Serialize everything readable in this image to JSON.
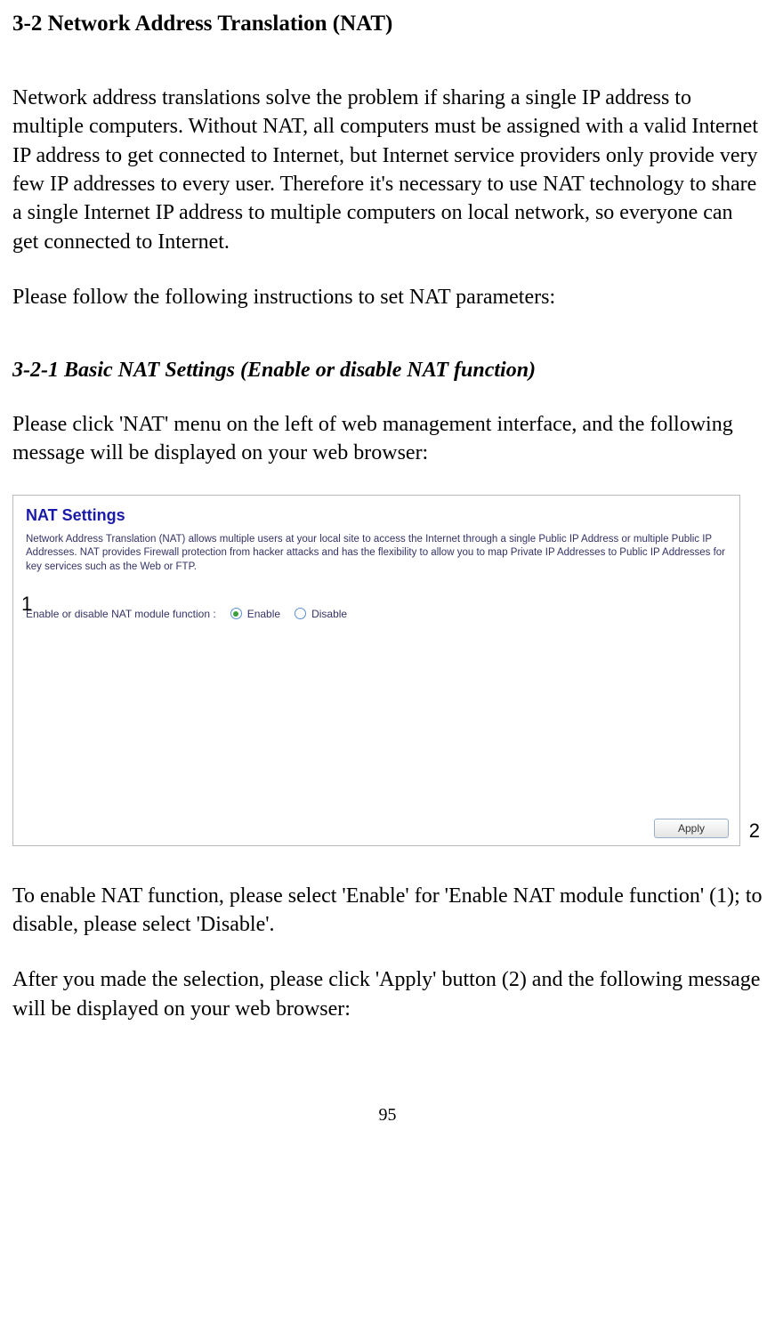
{
  "section": {
    "title": "3-2 Network Address Translation (NAT)",
    "para1": "Network address translations solve the problem if sharing a single IP address to multiple computers. Without NAT, all computers must be assigned with a valid Internet IP address to get connected to Internet, but Internet service providers only provide very few IP addresses to every user. Therefore it's necessary to use NAT technology to share a single Internet IP address to multiple computers on local network, so everyone can get connected to Internet.",
    "para2": "Please follow the following instructions to set NAT parameters:"
  },
  "subsection": {
    "title": "3-2-1 Basic NAT Settings (Enable or disable NAT function)",
    "para1": "Please click 'NAT' menu on the left of web management interface, and the following message will be displayed on your web browser:"
  },
  "screenshot": {
    "title": "NAT Settings",
    "desc": "Network Address Translation (NAT) allows multiple users at your local site to access the Internet through a single Public IP Address or multiple Public IP Addresses. NAT provides Firewall protection from hacker attacks and has the flexibility to allow you to map Private IP Addresses to Public IP Addresses for key services such as the Web or FTP.",
    "row_label": "Enable or disable NAT module function :",
    "option_enable": "Enable",
    "option_disable": "Disable",
    "apply_label": "Apply",
    "callout1": "1",
    "callout2": "2"
  },
  "after": {
    "para1": "To enable NAT function, please select 'Enable' for 'Enable NAT module function' (1); to disable, please select 'Disable'.",
    "para2": "After you made the selection, please click 'Apply' button (2) and the following message will be displayed on your web browser:"
  },
  "page_number": "95"
}
